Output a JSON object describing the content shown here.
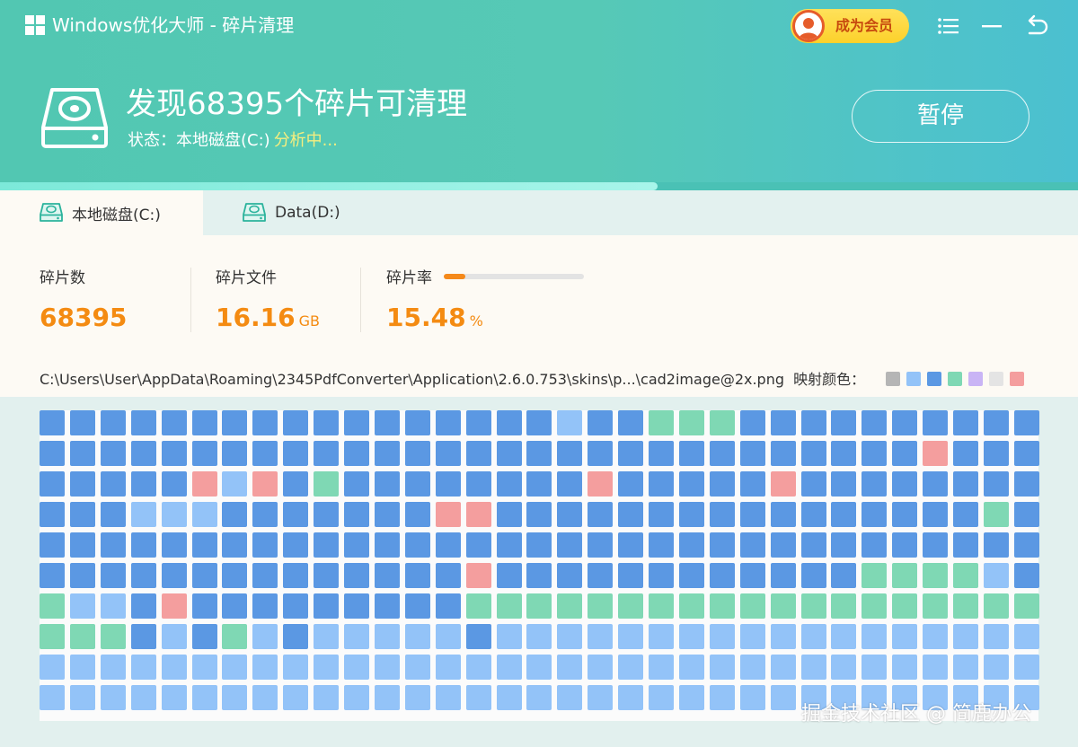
{
  "app": {
    "title": "Windows优化大师 - 碎片清理",
    "vip_label": "成为会员"
  },
  "header": {
    "headline": "发现68395个碎片可清理",
    "status_prefix": "状态：本地磁盘(C:)",
    "status_state": "分析中...",
    "pause_label": "暂停",
    "progress": 0.61
  },
  "tabs": [
    {
      "label": "本地磁盘(C:)",
      "active": true
    },
    {
      "label": "Data(D:)",
      "active": false
    }
  ],
  "stats": {
    "fragments": {
      "label": "碎片数",
      "value": "68395"
    },
    "fragment_files": {
      "label": "碎片文件",
      "value": "16.16",
      "unit": "GB"
    },
    "fragment_rate": {
      "label": "碎片率",
      "value": "15.48",
      "unit": "%",
      "fraction": 0.1548
    }
  },
  "current_file": "C:\\Users\\User\\AppData\\Roaming\\2345PdfConverter\\Application\\2.6.0.753\\skins\\p...\\cad2image@2x.png",
  "legend": {
    "label": "映射颜色：",
    "colors": [
      "#b5b5b5",
      "#93c3f8",
      "#5b98e3",
      "#7fd8b4",
      "#c9b4f5",
      "#e4e4e4",
      "#f49e9e"
    ]
  },
  "map": {
    "palette": {
      "D": "#5b98e3",
      "L": "#93c3f8",
      "G": "#7fd8b4",
      "R": "#f49e9e"
    },
    "rows": [
      "DDDDDDDDDDDDDDDDDLDDGGGDDDDDDDDDD",
      "DDDDDDDDDDDDDDDDDDDDDDDDDDDDDRDDD",
      "DDDDDRLRDGDDDDDDDDRDDDDDRDDDDDDDD",
      "DDDLLLDDDDDDDRRDDDDDDDDDDDDDDDDGD",
      "DDDDDDDDDDDDDDDDDDDDDDDDDDDDDDDDD",
      "DDDDDDDDDDDDDDRDDDDDDDDDDDDGGGGLDDL",
      "GLLDRDDDDDDDDDGGGGGGGGGGGGGGGGGGG",
      "GGGDLDGLDLLLLLDLLLLLLLLLLLLLLLLLL",
      "LLLLLLLLLLLLLLLLLLLLLLLLLLLLLLLLL",
      "LLLLLLLLLLLLLLLLLLLLLLLLLLLLLLLLL"
    ]
  },
  "watermark": "掘金技术社区 @ 简鹿办公"
}
